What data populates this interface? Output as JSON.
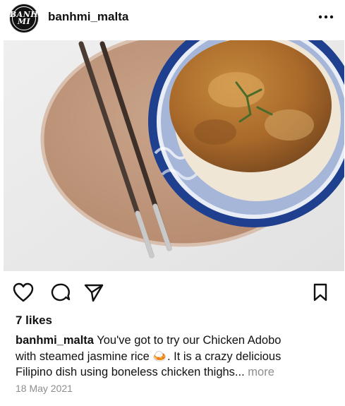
{
  "post": {
    "username": "banhmi_malta",
    "avatar": {
      "icon": "banh-mi-logo",
      "line1": "BANH",
      "line2": "MI"
    },
    "more_icon": "more-horizontal-icon",
    "photo": {
      "icon": "food-photo"
    },
    "actions": {
      "like_icon": "heart-icon",
      "comment_icon": "comment-icon",
      "share_icon": "paper-plane-icon",
      "save_icon": "bookmark-icon"
    },
    "likes": "7 likes",
    "caption": {
      "user": "banhmi_malta",
      "line1": "You've got to try our Chicken Adobo",
      "line2_pre": "with steamed jasmine rice ",
      "emoji": "🍛",
      "line2_post": ". It is a crazy delicious",
      "line3": "Filipino dish using boneless chicken thighs...",
      "more_label": "more"
    },
    "date": "18 May 2021"
  }
}
